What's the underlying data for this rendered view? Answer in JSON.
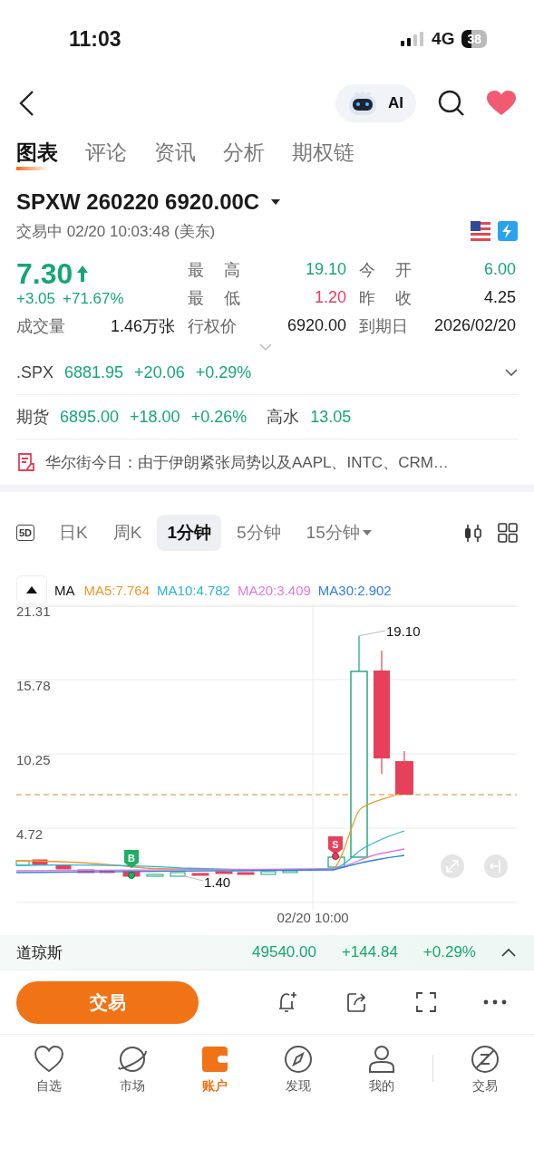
{
  "status_bar": {
    "time": "11:03",
    "network": "4G",
    "battery": "38"
  },
  "nav": {
    "ai_label": "AI"
  },
  "tabs": [
    {
      "label": "图表",
      "selected": true
    },
    {
      "label": "评论",
      "selected": false
    },
    {
      "label": "资讯",
      "selected": false
    },
    {
      "label": "分析",
      "selected": false
    },
    {
      "label": "期权链",
      "selected": false
    }
  ],
  "contract": {
    "title": "SPXW 260220 6920.00C",
    "status": "交易中 02/20 10:03:48 (美东)"
  },
  "quote": {
    "price": "7.30",
    "change": "+3.05",
    "change_pct": "+71.67%",
    "stats": [
      {
        "label": "最高",
        "value": "19.10",
        "color": "#17a673"
      },
      {
        "label": "今开",
        "value": "6.00",
        "color": "#17a673"
      },
      {
        "label": "最低",
        "value": "1.20",
        "color": "#e6405a"
      },
      {
        "label": "昨收",
        "value": "4.25",
        "color": "#1a1a1a"
      },
      {
        "label": "成交量",
        "value": "1.46万张",
        "color": "#1a1a1a"
      },
      {
        "label": "行权价",
        "value": "6920.00",
        "color": "#1a1a1a"
      },
      {
        "label": "到期日",
        "value": "2026/02/20",
        "color": "#1a1a1a"
      }
    ]
  },
  "underlying": {
    "name": ".SPX",
    "price": "6881.95",
    "change": "+20.06",
    "change_pct": "+0.29%"
  },
  "futures": {
    "name": "期货",
    "price": "6895.00",
    "change": "+18.00",
    "change_pct": "+0.26%",
    "premium_label": "高水",
    "premium": "13.05"
  },
  "news": {
    "text": "华尔街今日：由于伊朗紧张局势以及AAPL、INTC、CRM…"
  },
  "periods": {
    "icon_label": "5D",
    "items": [
      {
        "label": "日K",
        "selected": false,
        "dropdown": false
      },
      {
        "label": "周K",
        "selected": false,
        "dropdown": false
      },
      {
        "label": "1分钟",
        "selected": true,
        "dropdown": false
      },
      {
        "label": "5分钟",
        "selected": false,
        "dropdown": false
      },
      {
        "label": "15分钟",
        "selected": false,
        "dropdown": true
      }
    ]
  },
  "ma": {
    "label": "MA",
    "items": [
      {
        "text": "MA5:7.764",
        "color": "#f0962a"
      },
      {
        "text": "MA10:4.782",
        "color": "#2bb3d6"
      },
      {
        "text": "MA20:3.409",
        "color": "#e07ad8"
      },
      {
        "text": "MA30:2.902",
        "color": "#2f7fe0"
      }
    ]
  },
  "chart": {
    "yticks": [
      "21.31",
      "15.78",
      "10.25",
      "4.72"
    ],
    "xlabel": "02/20 10:00",
    "high_label": "19.10",
    "low_label": "1.40",
    "buy_mark": "B",
    "sell_mark": "S"
  },
  "ticker": {
    "name": "道琼斯",
    "price": "49540.00",
    "change": "+144.84",
    "change_pct": "+0.29%"
  },
  "actions": {
    "trade": "交易"
  },
  "bottom_nav": [
    {
      "label": "自选",
      "selected": false
    },
    {
      "label": "市场",
      "selected": false
    },
    {
      "label": "账户",
      "selected": true
    },
    {
      "label": "发现",
      "selected": false
    },
    {
      "label": "我的",
      "selected": false
    },
    {
      "label": "交易",
      "selected": false
    }
  ]
}
